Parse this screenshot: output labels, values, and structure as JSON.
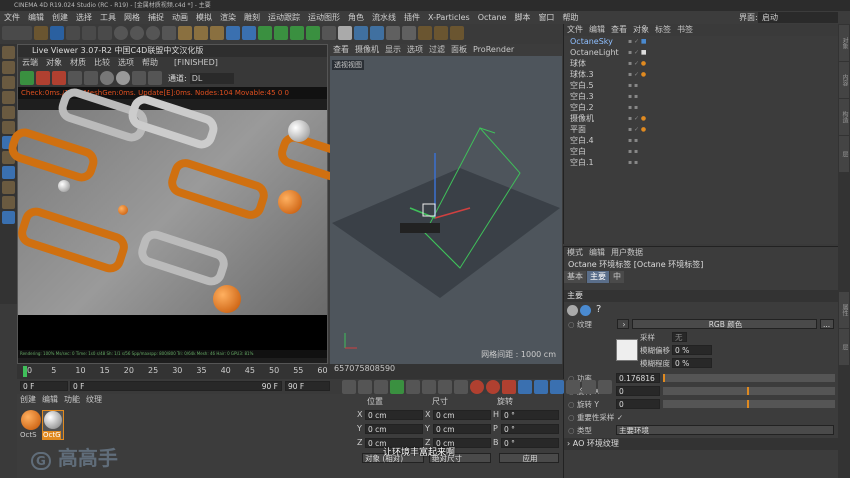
{
  "title_bar": "CINEMA 4D R19.024 Studio (RC - R19) - [金属材质视频.c4d *] - 主要",
  "menu": [
    "文件",
    "编辑",
    "创建",
    "选择",
    "工具",
    "网格",
    "捕捉",
    "动画",
    "模拟",
    "渲染",
    "雕刻",
    "运动跟踪",
    "运动图形",
    "角色",
    "流水线",
    "插件",
    "X-Particles",
    "Octane",
    "脚本",
    "窗口",
    "帮助"
  ],
  "layout_label": "界面:",
  "layout_value": "启动",
  "live_viewer": {
    "title": "Live Viewer 3.07-R2 中国C4D联盟中文汉化版",
    "menu": [
      "云端",
      "对象",
      "材质",
      "比较",
      "选项",
      "帮助"
    ],
    "finished": "[FINISHED]",
    "channel_label": "通道:",
    "channel_value": "DL",
    "status": "Check:0ms./1ms. MeshGen:0ms. Update[E]:0ms. Nodes:104 Movable:45  0 0",
    "bottom": "Rendering: 100%   Ms/sec: 0   Time: 1s0   s/48   Sh: 1/1   s/56   Spp/maxspp: 800/800   Tri: 0/64k   Mesh: 46   Hair: 0   GPU3: 81%"
  },
  "viewport": {
    "menu": [
      "查看",
      "摄像机",
      "显示",
      "选项",
      "过滤",
      "面板",
      "ProRender"
    ],
    "label": "透视视图",
    "grid": "网格间距 : 1000 cm"
  },
  "object_manager": {
    "menu": [
      "文件",
      "编辑",
      "查看",
      "对象",
      "标签",
      "书签"
    ],
    "items": [
      {
        "name": "OctaneSky",
        "selected": true
      },
      {
        "name": "OctaneLight",
        "selected": false
      },
      {
        "name": "球体",
        "selected": false
      },
      {
        "name": "球体.3",
        "selected": false
      },
      {
        "name": "空白.5",
        "selected": false
      },
      {
        "name": "空白.3",
        "selected": false
      },
      {
        "name": "空白.2",
        "selected": false
      },
      {
        "name": "摄像机",
        "selected": false
      },
      {
        "name": "平面",
        "selected": false
      },
      {
        "name": "空白.4",
        "selected": false
      },
      {
        "name": "空白",
        "selected": false
      },
      {
        "name": "空白.1",
        "selected": false
      }
    ]
  },
  "attributes": {
    "menu": [
      "模式",
      "编辑",
      "用户数据"
    ],
    "header": "Octane 环境标签 [Octane 环境标签]",
    "tabs": [
      "基本",
      "主要",
      "中"
    ],
    "section": "主要",
    "texture_label": "纹理",
    "texture_value": "RGB 颜色",
    "sample_label": "采样",
    "sample_value": "无",
    "blur_offset_label": "模糊偏移",
    "blur_offset_value": "0 %",
    "blur_range_label": "模糊程度",
    "blur_range_value": "0 %",
    "power_label": "功率",
    "power_value": "0.176816",
    "power_fraction": 0.18,
    "rotx_label": "旋转 X",
    "rotx_value": "0",
    "roty_label": "旋转 Y",
    "roty_value": "0",
    "importance_label": "重要性采样",
    "importance_value": "✓",
    "type_label": "类型",
    "type_value": "主要环境",
    "ao_label": "AO 环境纹理"
  },
  "timeline": {
    "ticks": [
      "0",
      "5",
      "10",
      "15",
      "20",
      "25",
      "30",
      "35",
      "40",
      "45",
      "50",
      "55",
      "60",
      "65",
      "70",
      "75",
      "80",
      "85",
      "90"
    ],
    "start": "0 F",
    "current": "0 F",
    "end1": "90 F",
    "end2": "90 F",
    "frame_indicator": "0 F"
  },
  "material_manager": {
    "menu": [
      "创建",
      "编辑",
      "功能",
      "纹理"
    ],
    "materials": [
      "OctS",
      "OctG"
    ]
  },
  "coordinates": {
    "headers": [
      "位置",
      "尺寸",
      "旋转"
    ],
    "rows": [
      {
        "a": "X",
        "av": "0 cm",
        "b": "X",
        "bv": "0 cm",
        "c": "H",
        "cv": "0 °"
      },
      {
        "a": "Y",
        "av": "0 cm",
        "b": "Y",
        "bv": "0 cm",
        "c": "P",
        "cv": "0 °"
      },
      {
        "a": "Z",
        "av": "0 cm",
        "b": "Z",
        "bv": "0 cm",
        "c": "B",
        "cv": "0 °"
      }
    ],
    "mode": "对象 (相对)",
    "size_mode": "绝对尺寸",
    "apply": "应用"
  },
  "subtitle": "让环境丰富起来啊",
  "watermark": "高高手"
}
